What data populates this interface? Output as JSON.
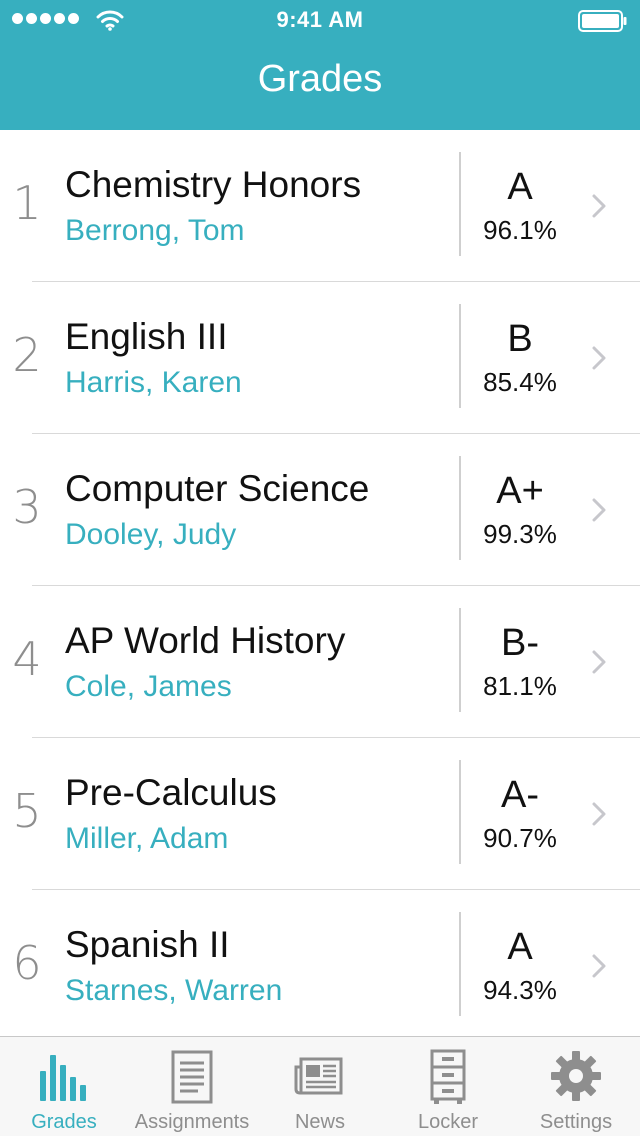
{
  "status_bar": {
    "time": "9:41 AM"
  },
  "nav": {
    "title": "Grades"
  },
  "courses": [
    {
      "rank": "1",
      "name": "Chemistry Honors",
      "teacher": "Berrong, Tom",
      "letter": "A",
      "percent": "96.1%"
    },
    {
      "rank": "2",
      "name": "English III",
      "teacher": "Harris, Karen",
      "letter": "B",
      "percent": "85.4%"
    },
    {
      "rank": "3",
      "name": "Computer Science",
      "teacher": "Dooley, Judy",
      "letter": "A+",
      "percent": "99.3%"
    },
    {
      "rank": "4",
      "name": "AP World History",
      "teacher": "Cole, James",
      "letter": "B-",
      "percent": "81.1%"
    },
    {
      "rank": "5",
      "name": "Pre-Calculus",
      "teacher": "Miller, Adam",
      "letter": "A-",
      "percent": "90.7%"
    },
    {
      "rank": "6",
      "name": "Spanish II",
      "teacher": "Starnes, Warren",
      "letter": "A",
      "percent": "94.3%"
    }
  ],
  "tabbar": {
    "tabs": [
      {
        "label": "Grades",
        "icon": "grades-bars-icon",
        "active": true
      },
      {
        "label": "Assignments",
        "icon": "assignments-document-icon",
        "active": false
      },
      {
        "label": "News",
        "icon": "news-newspaper-icon",
        "active": false
      },
      {
        "label": "Locker",
        "icon": "locker-cabinet-icon",
        "active": false
      },
      {
        "label": "Settings",
        "icon": "settings-gear-icon",
        "active": false
      }
    ]
  },
  "colors": {
    "accent": "#37afbf",
    "header_bg": "#37afbf",
    "inactive": "#8e8e8e",
    "separator": "#d9d9d9"
  }
}
